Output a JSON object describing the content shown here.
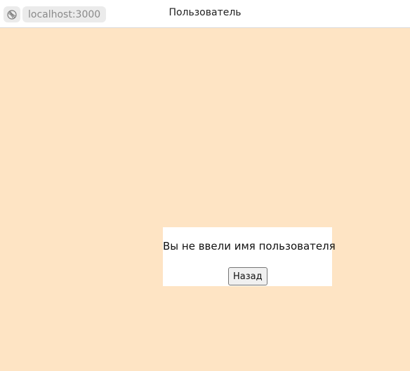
{
  "browser": {
    "url": "localhost:3000",
    "page_title": "Пользователь",
    "site_icon": "globe-icon"
  },
  "colors": {
    "page_background": "#FEE4C4",
    "card_background": "#FFFFFF"
  },
  "card": {
    "message": "Вы не ввели имя пользователя",
    "back_button_label": "Назад"
  }
}
